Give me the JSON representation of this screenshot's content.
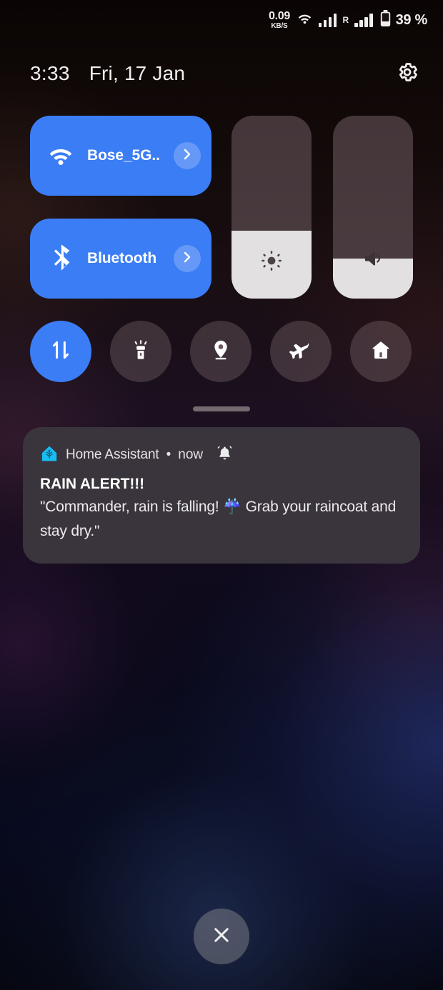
{
  "status_bar": {
    "net_rate": "0.09",
    "net_unit": "KB/S",
    "wifi_icon": "wifi-icon",
    "signal1_icon": "signal-bars-icon",
    "roaming": "R",
    "signal2_icon": "signal-bars-icon",
    "battery_icon": "battery-icon",
    "battery_percent": "39 %"
  },
  "header": {
    "time": "3:33",
    "date": "Fri, 17 Jan",
    "settings_icon": "gear-icon"
  },
  "tiles": [
    {
      "id": "wifi",
      "label": "Bose_5G..",
      "icon": "wifi-icon",
      "chevron_icon": "chevron-right-icon",
      "state": "on",
      "color": "#3b7df5"
    },
    {
      "id": "bluetooth",
      "label": "Bluetooth",
      "icon": "bluetooth-icon",
      "chevron_icon": "chevron-right-icon",
      "state": "on",
      "color": "#3b7df5"
    }
  ],
  "sliders": [
    {
      "id": "brightness",
      "icon": "brightness-icon",
      "percent": 37,
      "track_color": "#473a3e",
      "fill_color": "#e2e0e0"
    },
    {
      "id": "volume",
      "icon": "volume-icon",
      "percent": 22,
      "track_color": "#473a3e",
      "fill_color": "#e2e0e0"
    }
  ],
  "toggles": [
    {
      "id": "mobile-data",
      "icon": "mobile-data-icon",
      "active": true,
      "color": "#3b7df5"
    },
    {
      "id": "flashlight",
      "icon": "flashlight-icon",
      "active": false,
      "color": "#6b585e"
    },
    {
      "id": "location",
      "icon": "location-pin-icon",
      "active": false,
      "color": "#6b585e"
    },
    {
      "id": "airplane",
      "icon": "airplane-icon",
      "active": false,
      "color": "#6b585e"
    },
    {
      "id": "home",
      "icon": "home-icon",
      "active": false,
      "color": "#6b585e"
    }
  ],
  "drag_handle": {
    "name": "drag-handle"
  },
  "notification": {
    "app_name": "Home Assistant",
    "separator": "•",
    "time": "now",
    "app_icon": "home-assistant-icon",
    "alert_icon": "bell-ringing-icon",
    "title": "RAIN ALERT!!!",
    "body": "\"Commander, rain is falling! ☔ Grab your raincoat and stay dry.\"",
    "card_color": "#3a343c"
  },
  "close_button": {
    "icon": "close-icon",
    "label": ""
  }
}
